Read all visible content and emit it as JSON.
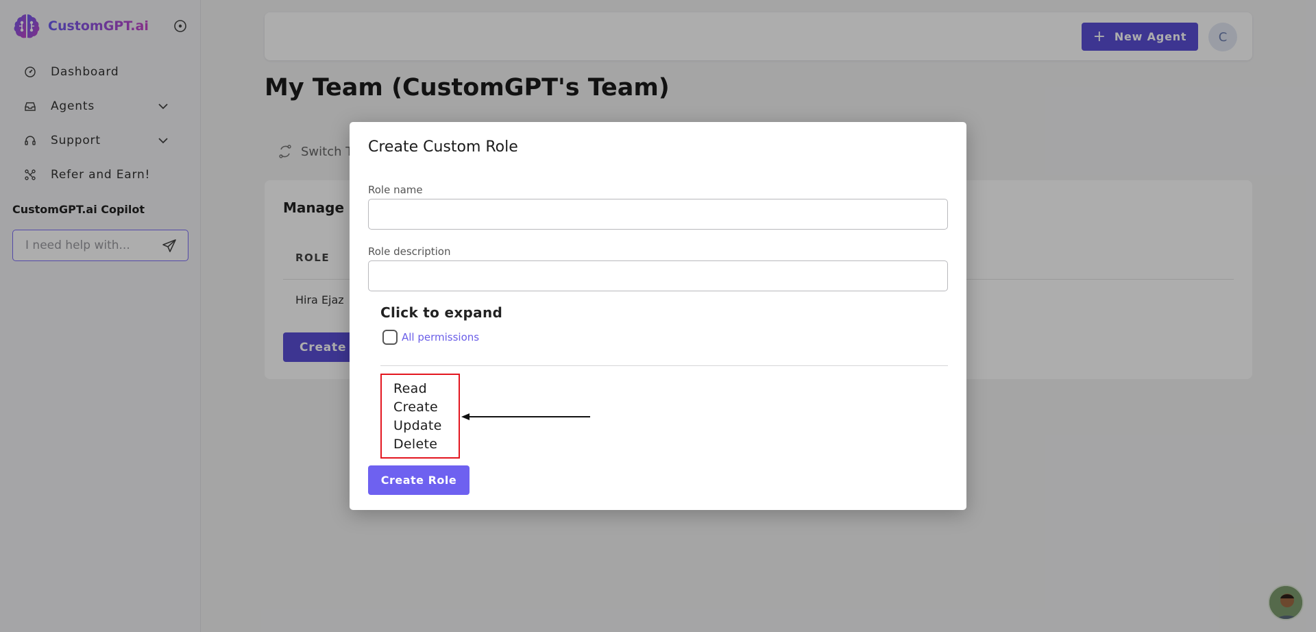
{
  "sidebar": {
    "logo_text": "CustomGPT.ai",
    "nav": [
      {
        "label": "Dashboard",
        "icon": "gauge-icon"
      },
      {
        "label": "Agents",
        "icon": "inbox-icon",
        "expandable": true
      },
      {
        "label": "Support",
        "icon": "headset-icon",
        "expandable": true
      },
      {
        "label": "Refer and Earn!",
        "icon": "share-icon"
      }
    ],
    "copilot": {
      "title": "CustomGPT.ai Copilot",
      "placeholder": "I need help with..."
    }
  },
  "topbar": {
    "new_agent_label": "New Agent",
    "avatar_initial": "C"
  },
  "page": {
    "title": "My Team (CustomGPT's Team)",
    "switch_team_label": "Switch T"
  },
  "card": {
    "title": "Manage R",
    "column_header": "ROLE",
    "row_value": "Hira Ejaz",
    "create_label": "Create C"
  },
  "modal": {
    "title": "Create Custom Role",
    "role_name_label": "Role name",
    "role_name_value": "",
    "role_description_label": "Role description",
    "role_description_value": "",
    "expand_label": "Click to expand",
    "all_permissions_label": "All permissions",
    "all_permissions_checked": false,
    "permissions": [
      "Read",
      "Create",
      "Update",
      "Delete"
    ],
    "create_role_label": "Create Role"
  },
  "colors": {
    "brand": "#5a4fd6",
    "modal_button": "#6e61f0",
    "highlight_border": "#e3161f",
    "link": "#6a5ee8"
  }
}
